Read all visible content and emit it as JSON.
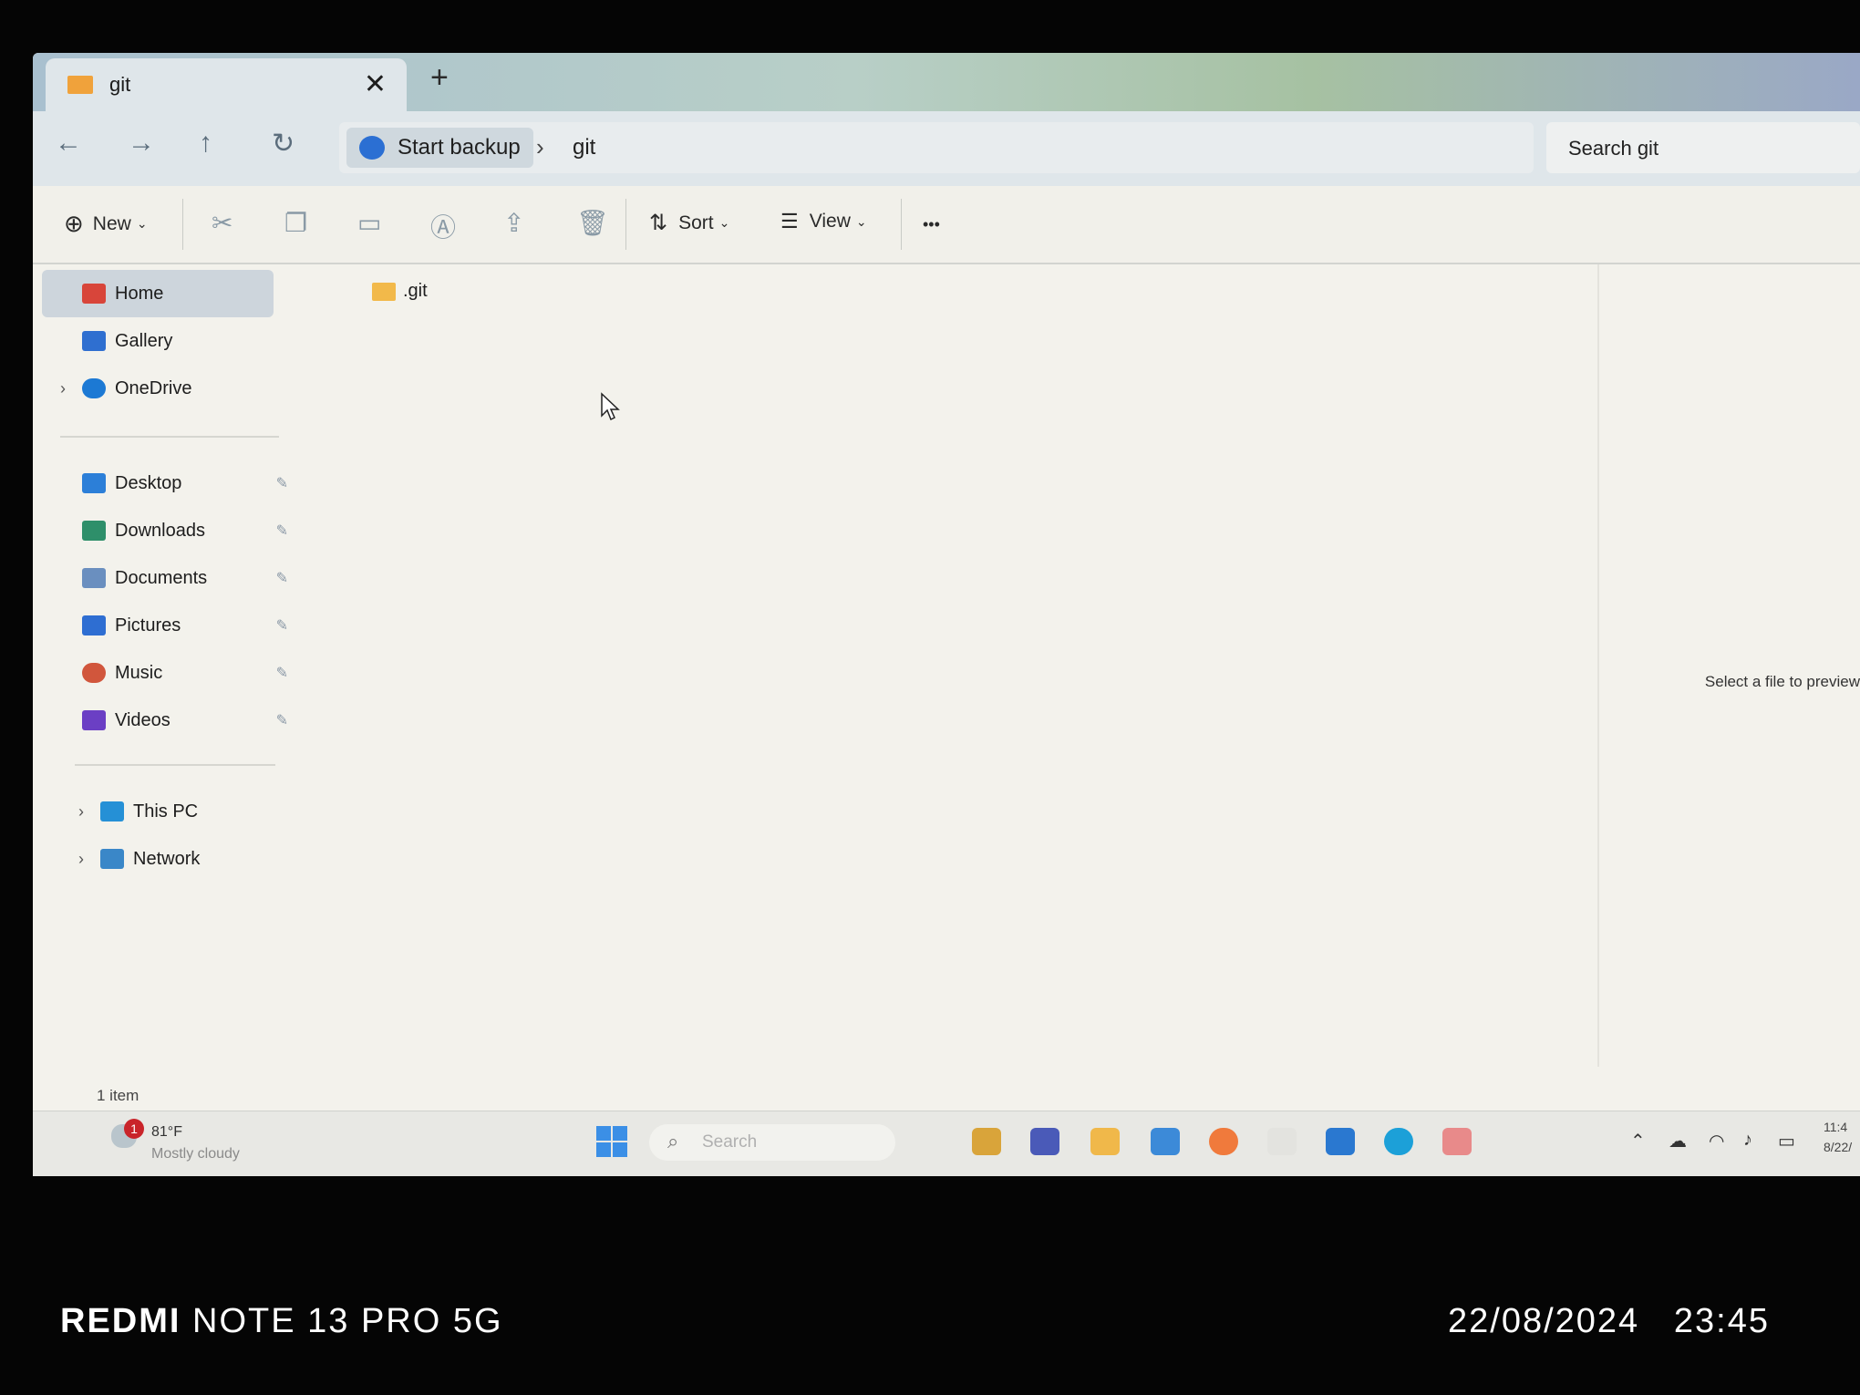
{
  "window": {
    "tab_title": "git",
    "close_glyph": "✕",
    "new_tab_glyph": "+"
  },
  "navigation": {
    "back_glyph": "←",
    "forward_glyph": "→",
    "up_glyph": "↑",
    "refresh_glyph": "↻",
    "breadcrumb": [
      "Start backup",
      "git"
    ],
    "separator": "›",
    "search_placeholder": "Search git"
  },
  "commands": {
    "new_label": "New",
    "sort_label": "Sort",
    "view_label": "View",
    "more_glyph": "•••"
  },
  "sidebar": {
    "top_items": [
      {
        "label": "Home",
        "icon": "home-icon",
        "selected": true
      },
      {
        "label": "Gallery",
        "icon": "gallery-icon"
      },
      {
        "label": "OneDrive",
        "icon": "onedrive-icon"
      }
    ],
    "pinned_items": [
      {
        "label": "Desktop",
        "icon": "desktop-icon"
      },
      {
        "label": "Downloads",
        "icon": "downloads-icon"
      },
      {
        "label": "Documents",
        "icon": "documents-icon"
      },
      {
        "label": "Pictures",
        "icon": "pictures-icon"
      },
      {
        "label": "Music",
        "icon": "music-icon"
      },
      {
        "label": "Videos",
        "icon": "videos-icon"
      }
    ],
    "bottom_items": [
      {
        "label": "This PC",
        "icon": "this-pc-icon"
      },
      {
        "label": "Network",
        "icon": "network-icon"
      }
    ],
    "pin_glyph": "📌",
    "chevron_glyph": "›"
  },
  "content": {
    "files": [
      {
        "name": ".git",
        "type": "folder"
      }
    ],
    "preview_hint": "Select a file to preview",
    "status": "1 item"
  },
  "taskbar": {
    "weather_badge": "1",
    "temperature": "81°F",
    "condition": "Mostly cloudy",
    "search_placeholder": "Search",
    "clock_time": "11:4",
    "clock_date": "8/22/"
  },
  "watermark": {
    "brand": "REDMI",
    "model": "NOTE 13 PRO 5G",
    "date": "22/08/2024",
    "time": "23:45"
  },
  "colors": {
    "accent": "#2b6fd3",
    "folder": "#f2b94a",
    "selected_bg": "#cdd5dc",
    "badge": "#c9242a"
  }
}
